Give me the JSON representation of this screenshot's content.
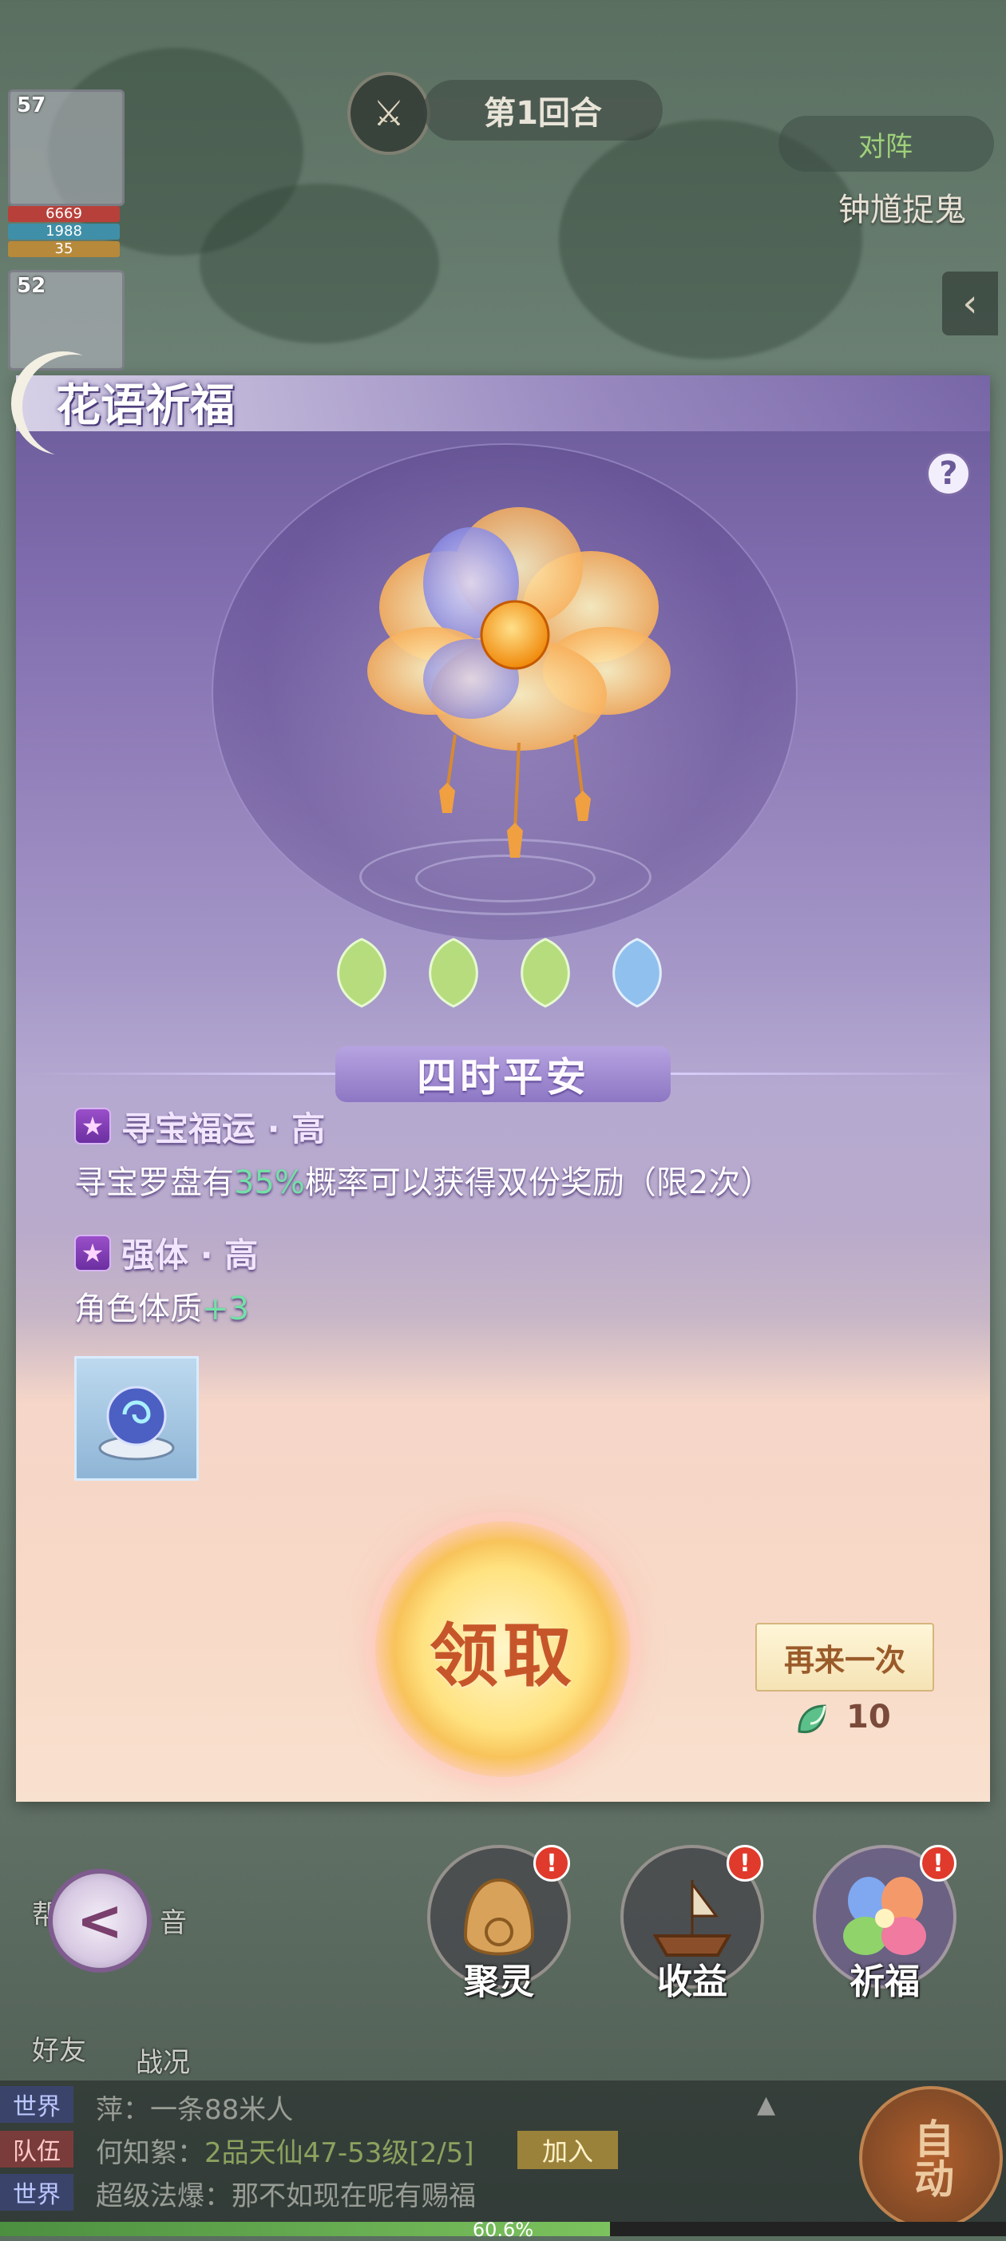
{
  "battle": {
    "round_label": "第1回合",
    "hero_levels": [
      "57",
      "52"
    ],
    "hero_stats": [
      "6669",
      "1988",
      "35"
    ],
    "vs_label": "对阵",
    "boss_name": "钟馗捉鬼"
  },
  "panel": {
    "title": "花语祈福",
    "help_symbol": "?",
    "banner": "四时平安",
    "attributes": [
      {
        "title": "寻宝福运 · 高",
        "desc_prefix": "寻宝罗盘有",
        "desc_highlight": "35%",
        "desc_suffix": "概率可以获得双份奖励（限2次）"
      },
      {
        "title": "强体 · 高",
        "desc_prefix": "角色体质",
        "desc_highlight": "+3",
        "desc_suffix": ""
      }
    ],
    "petal_colors": [
      "#b7e07a",
      "#b7e07a",
      "#b7e07a",
      "#8fc3f0"
    ],
    "claim_label": "领取",
    "again_label": "再来一次",
    "cost_value": "10"
  },
  "dock": {
    "back_symbol": "<",
    "buttons": [
      {
        "label": "聚灵",
        "badge": "!"
      },
      {
        "label": "收益",
        "badge": "!"
      },
      {
        "label": "祈福",
        "badge": "!"
      }
    ],
    "side_labels": [
      "帮",
      "音",
      "好友",
      "战况"
    ]
  },
  "chat": {
    "expand_symbol": "▲",
    "lines": [
      {
        "tag": "世界",
        "text": "萍：一条88米人",
        "highlight": ""
      },
      {
        "tag": "队伍",
        "text": "何知絮：",
        "highlight": "2品天仙47-53级[2/5]"
      },
      {
        "tag": "世界",
        "text": "超级法爆：那不如现在呢有赐福",
        "highlight": ""
      }
    ],
    "join_label": "加入",
    "auto_label": "自动",
    "exp_percent": "60.6%",
    "exp_fraction": 0.606
  }
}
